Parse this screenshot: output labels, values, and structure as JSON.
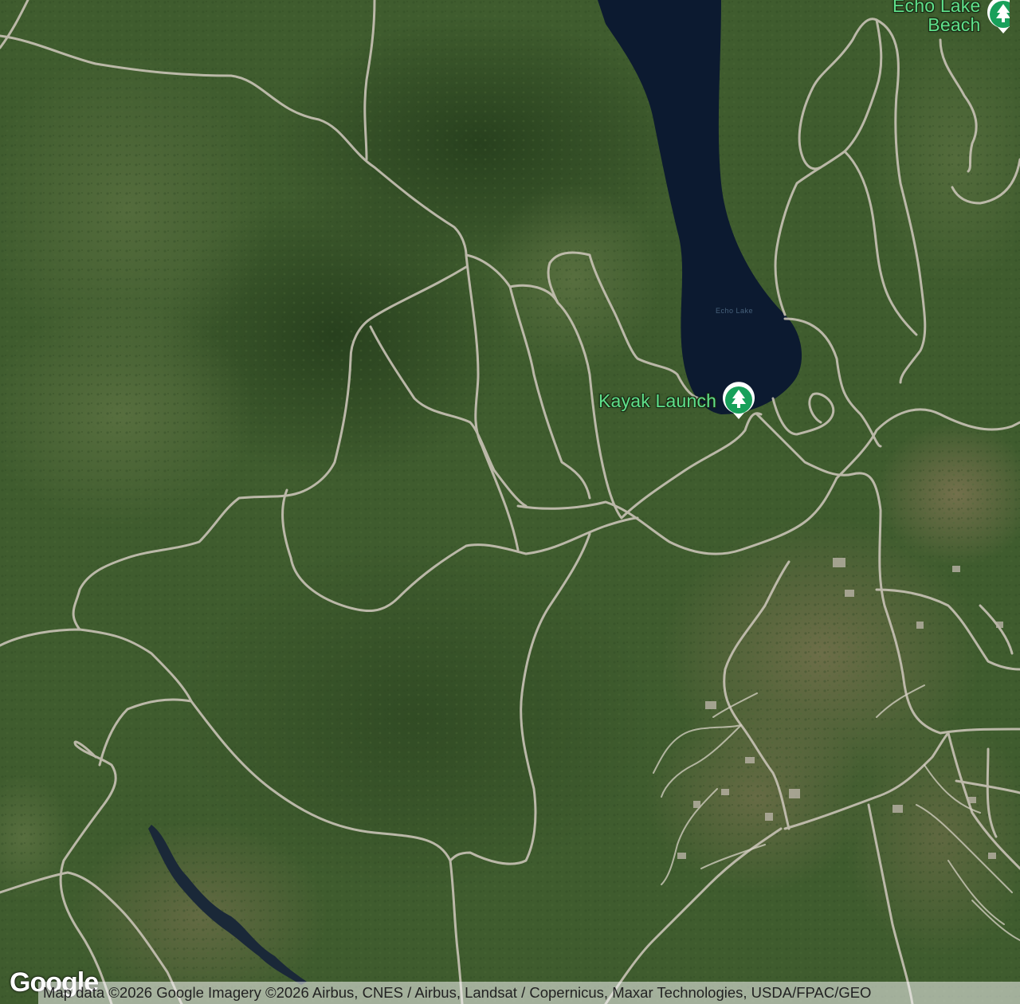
{
  "map": {
    "type": "satellite",
    "colors": {
      "forest": "#3d5a2c",
      "forest_dark": "#2c4622",
      "forest_light": "#5a7040",
      "water": "#0c1a30",
      "trail": "#c9c3b6",
      "poi_green": "#18a05a",
      "label_green": "#5fe08a"
    }
  },
  "pois": {
    "kayak": {
      "label": "Kayak Launch",
      "icon": "tree-icon"
    },
    "echo": {
      "label_line1": "Echo Lake",
      "label_line2": "Beach",
      "icon": "tree-icon"
    }
  },
  "water_label": "Echo Lake",
  "footer": {
    "logo": "Google",
    "attribution": "Map data ©2026 Google Imagery ©2026 Airbus, CNES / Airbus, Landsat / Copernicus, Maxar Technologies, USDA/FPAC/GEO"
  }
}
